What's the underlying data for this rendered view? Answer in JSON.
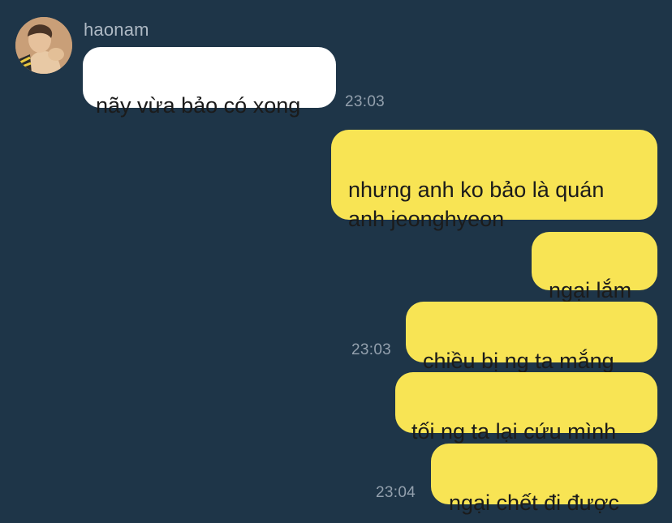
{
  "chat": {
    "background": "#1e3548",
    "incoming_color": "#ffffff",
    "outgoing_color": "#f8e454"
  },
  "contact": {
    "name": "haonam",
    "avatar": "profile-photo"
  },
  "messages": [
    {
      "sender": "haonam",
      "text": "nãy vừa bảo có xong"
    },
    {
      "sender": "me",
      "text": "nhưng anh ko bảo là quán\nanh jeonghyeon"
    },
    {
      "sender": "me",
      "text": "ngại lắm"
    },
    {
      "sender": "me",
      "text": "chiều bị ng ta mắng"
    },
    {
      "sender": "me",
      "text": "tối ng ta lại cứu mình"
    },
    {
      "sender": "me",
      "text": "ngại chết đi được"
    }
  ],
  "timestamps": [
    "23:03",
    "23:03",
    "23:04"
  ]
}
